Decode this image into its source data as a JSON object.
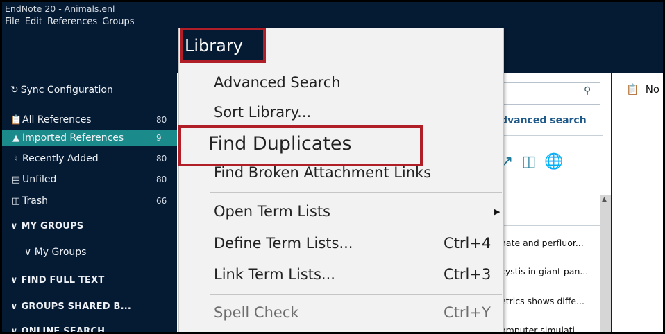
{
  "window": {
    "title": "EndNote 20 - Animals.enl"
  },
  "menubar": {
    "items": [
      "File",
      "Edit",
      "References",
      "Groups"
    ]
  },
  "sidebar": {
    "sync": "Sync Configuration",
    "groups": [
      {
        "label": "All References",
        "count": "80",
        "icon": "clipboard-icon"
      },
      {
        "label": "Imported References",
        "count": "9",
        "icon": "import-icon"
      },
      {
        "label": "Recently Added",
        "count": "80",
        "icon": "bell-icon"
      },
      {
        "label": "Unfiled",
        "count": "80",
        "icon": "clipboard-icon"
      },
      {
        "label": "Trash",
        "count": "66",
        "icon": "trash-icon"
      }
    ],
    "sections": [
      "MY GROUPS",
      "My Groups",
      "FIND FULL TEXT",
      "GROUPS SHARED B...",
      "ONLINE SEARCH"
    ]
  },
  "middle": {
    "advanced_search": "dvanced search",
    "refs": [
      "nate and perfluor...",
      "cystis in giant pan...",
      "etrics shows diffe...",
      "omputer simulati"
    ]
  },
  "right": {
    "label": "No"
  },
  "library_menu": {
    "title": "Library",
    "items": {
      "advanced_search": "Advanced Search",
      "sort_library": "Sort Library...",
      "find_duplicates": "Find Duplicates",
      "find_broken": "Find Broken Attachment Links",
      "open_term_lists": "Open Term Lists",
      "define_term_lists": "Define Term Lists...",
      "define_shortcut": "Ctrl+4",
      "link_term_lists": "Link Term Lists...",
      "link_shortcut": "Ctrl+3",
      "spell_check": "Spell Check",
      "spell_shortcut": "Ctrl+Y"
    }
  },
  "colors": {
    "sidebar_bg": "#051a33",
    "selected_bg": "#1b8a8a",
    "highlight": "#b01e28"
  }
}
